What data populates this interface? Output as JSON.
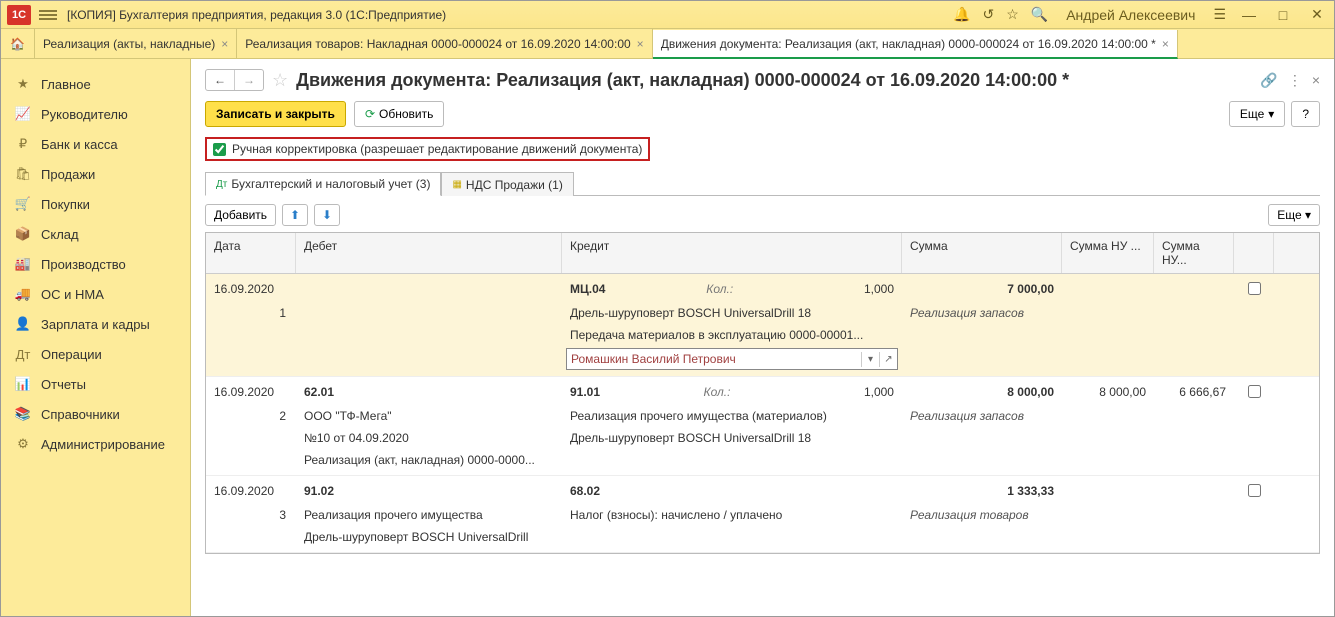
{
  "titlebar": {
    "title": "[КОПИЯ] Бухгалтерия предприятия, редакция 3.0  (1С:Предприятие)",
    "user": "Андрей Алексеевич"
  },
  "tabs": {
    "t1": "Реализация (акты, накладные)",
    "t2": "Реализация товаров: Накладная 0000-000024 от 16.09.2020 14:00:00",
    "t3": "Движения документа: Реализация (акт, накладная) 0000-000024 от 16.09.2020 14:00:00 *"
  },
  "sidebar": {
    "items": [
      {
        "label": "Главное"
      },
      {
        "label": "Руководителю"
      },
      {
        "label": "Банк и касса"
      },
      {
        "label": "Продажи"
      },
      {
        "label": "Покупки"
      },
      {
        "label": "Склад"
      },
      {
        "label": "Производство"
      },
      {
        "label": "ОС и НМА"
      },
      {
        "label": "Зарплата и кадры"
      },
      {
        "label": "Операции"
      },
      {
        "label": "Отчеты"
      },
      {
        "label": "Справочники"
      },
      {
        "label": "Администрирование"
      }
    ]
  },
  "page": {
    "title": "Движения документа: Реализация (акт, накладная) 0000-000024 от 16.09.2020 14:00:00 *",
    "save_close": "Записать и закрыть",
    "refresh": "Обновить",
    "more": "Еще",
    "help": "?",
    "checkbox_label": "Ручная корректировка (разрешает редактирование движений документа)",
    "tab_acc": "Бухгалтерский и налоговый учет (3)",
    "tab_vat": "НДС Продажи (1)",
    "add": "Добавить"
  },
  "grid": {
    "headers": {
      "date": "Дата",
      "debit": "Дебет",
      "credit": "Кредит",
      "sum": "Сумма",
      "sumnu1": "Сумма НУ ...",
      "sumnu2": "Сумма НУ..."
    },
    "rows": [
      {
        "hl": true,
        "date": "16.09.2020",
        "num": "1",
        "debit_acc": "",
        "credit_acc": "МЦ.04",
        "kol": "Кол.:",
        "qty": "1,000",
        "sum": "7 000,00",
        "credit_lines": [
          "Дрель-шуруповерт BOSCH UniversalDrill 18",
          "Передача материалов в эксплуатацию 0000-00001..."
        ],
        "sum_desc": "Реализация запасов",
        "edit_value": "Ромашкин Василий Петрович"
      },
      {
        "date": "16.09.2020",
        "num": "2",
        "debit_acc": "62.01",
        "credit_acc": "91.01",
        "kol": "Кол.:",
        "qty": "1,000",
        "sum": "8 000,00",
        "sumnu1": "8 000,00",
        "sumnu2": "6 666,67",
        "debit_lines": [
          "ООО \"ТФ-Мега\"",
          "№10 от 04.09.2020",
          "Реализация (акт, накладная) 0000-0000..."
        ],
        "credit_lines": [
          "Реализация прочего имущества (материалов)",
          "Дрель-шуруповерт BOSCH UniversalDrill 18"
        ],
        "sum_desc": "Реализация запасов"
      },
      {
        "date": "16.09.2020",
        "num": "3",
        "debit_acc": "91.02",
        "credit_acc": "68.02",
        "sum": "1 333,33",
        "debit_lines": [
          "Реализация прочего имущества",
          "Дрель-шуруповерт BOSCH UniversalDrill"
        ],
        "credit_lines": [
          "Налог (взносы): начислено / уплачено"
        ],
        "sum_desc": "Реализация товаров"
      }
    ]
  }
}
